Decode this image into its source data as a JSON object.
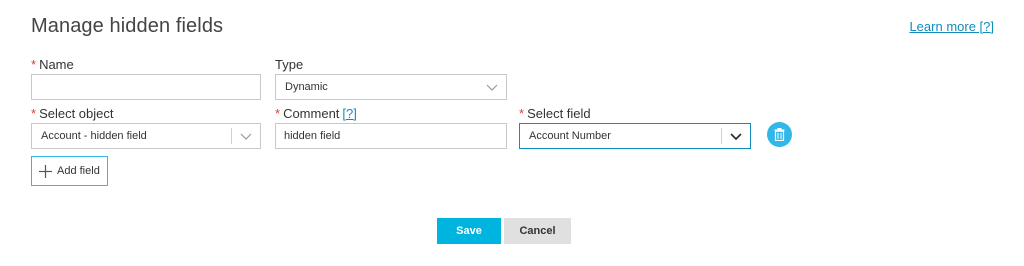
{
  "header": {
    "title": "Manage hidden fields",
    "learn_more": "Learn more [?]"
  },
  "form": {
    "required_mark": "*",
    "name": {
      "label": "Name",
      "value": "",
      "placeholder": ""
    },
    "type": {
      "label": "Type",
      "value": "Dynamic"
    },
    "select_object": {
      "label": "Select object",
      "value": "Account - hidden field"
    },
    "comment": {
      "label": "Comment",
      "help": "[?]",
      "value": "hidden field"
    },
    "select_field": {
      "label": "Select field",
      "value": "Account Number"
    }
  },
  "icons": {
    "trash": "trash-icon",
    "plus": "plus-icon",
    "chevron": "chevron-down-icon"
  },
  "actions": {
    "add_field": "Add field",
    "save": "Save",
    "cancel": "Cancel"
  },
  "colors": {
    "accent": "#00b4e0",
    "link": "#0f8dbc",
    "required": "#e23b2e",
    "trash_bg": "#31b7e8"
  }
}
